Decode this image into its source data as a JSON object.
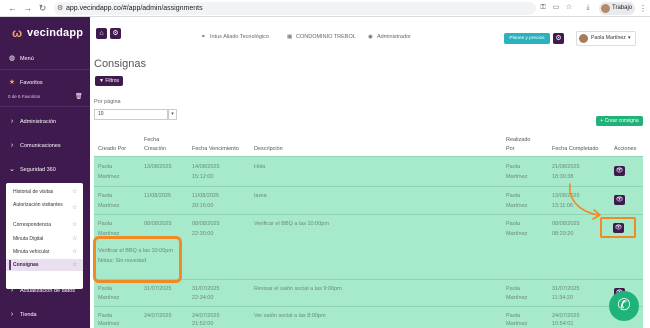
{
  "browser": {
    "url": "app.vecindapp.co/#/app/admin/assignments",
    "profile_label": "Trabajo"
  },
  "sidebar": {
    "logo_text": "vecindapp",
    "menu_label": "Menú",
    "favorites_label": "Favoritos",
    "favorites_sub": "0 de 5 Favoritos",
    "items": [
      {
        "label": "Administración"
      },
      {
        "label": "Comunicaciones"
      },
      {
        "label": "Seguridad 360"
      },
      {
        "label": "Actualización de datos"
      },
      {
        "label": "Tienda"
      }
    ],
    "submenu": [
      {
        "label": "Historial de visitas"
      },
      {
        "label": "Autorización visitantes"
      },
      {
        "label": "Correspondencia"
      },
      {
        "label": "Minuta Digital"
      },
      {
        "label": "Minuta vehicular"
      },
      {
        "label": "Consignas"
      }
    ]
  },
  "topbar": {
    "org": "Intus Aliado Tecnológico",
    "condo": "CONDOMINIO TREBOL",
    "role": "Administrador",
    "plans_button": "Planes y precios",
    "user_name": "Paola Martínez"
  },
  "main": {
    "title": "Consignas",
    "filter_button": "Filtros",
    "per_page_label": "Por página",
    "per_page_value": "10",
    "create_button": "+ Crear consigna",
    "headers": {
      "created_by": "Creado Por",
      "created_date_1": "Fecha",
      "created_date_2": "Creación",
      "due_date": "Fecha Vencimiento",
      "description": "Descripción",
      "done_by_1": "Realizado",
      "done_by_2": "Por",
      "done_date": "Fecha Completado",
      "actions": "Acciones"
    },
    "rows": [
      {
        "by_1": "Paola",
        "by_2": "Martínez",
        "created": "13/08/2025",
        "due_1": "14/08/2025",
        "due_2": "15:12:00",
        "desc": "Hola",
        "done_1": "Paola",
        "done_2": "Martínez",
        "completed_1": "21/08/2025",
        "completed_2": "18:39:38"
      },
      {
        "by_1": "Paola",
        "by_2": "Martínez",
        "created": "11/08/2025",
        "due_1": "11/08/2025",
        "due_2": "20:16:00",
        "desc": "tarea",
        "done_1": "Paola",
        "done_2": "Martínez",
        "completed_1": "13/08/2025",
        "completed_2": "13:11:06"
      },
      {
        "by_1": "Paola",
        "by_2": "Martínez",
        "created": "08/08/2025",
        "due_1": "08/08/2025",
        "due_2": "22:30:00",
        "desc": "Verificar el BBQ a las 10:00pm",
        "done_1": "Paola",
        "done_2": "Martínez",
        "completed_1": "08/08/2025",
        "completed_2": "08:29:20"
      },
      {
        "by_1": "Paola",
        "by_2": "Martínez",
        "created": "31/07/2025",
        "due_1": "31/07/2025",
        "due_2": "22:34:00",
        "desc": "Revisar el salón social a las 9:00pm",
        "done_1": "Paola",
        "done_2": "Martínez",
        "completed_1": "31/07/2025",
        "completed_2": "11:34:20"
      },
      {
        "by_1": "Paola",
        "by_2": "Martínez",
        "created": "24/07/2025",
        "due_1": "24/07/2025",
        "due_2": "21:52:00",
        "desc": "Ver salón social a las 8:00pm",
        "done_1": "Paola",
        "done_2": "Martínez",
        "completed_1": "24/07/2025",
        "completed_2": "10:54:01"
      }
    ],
    "expanded_detail": {
      "line1": "Verificar el BBQ a las 10:00pm",
      "line2": "Notas: Sin novedad"
    }
  },
  "colors": {
    "sidebar_bg": "#3f1a4f",
    "table_row_bg": "#a6e9cb",
    "accent_green": "#1fb37a",
    "accent_teal": "#2ab3bf",
    "annotation_orange": "#f08a24"
  },
  "icons": [
    "back-arrow-icon",
    "forward-arrow-icon",
    "reload-icon",
    "tune-icon",
    "eye-icon",
    "star-icon",
    "trash-icon",
    "home-icon",
    "gear-icon",
    "phone-icon",
    "chevron-right-icon"
  ]
}
